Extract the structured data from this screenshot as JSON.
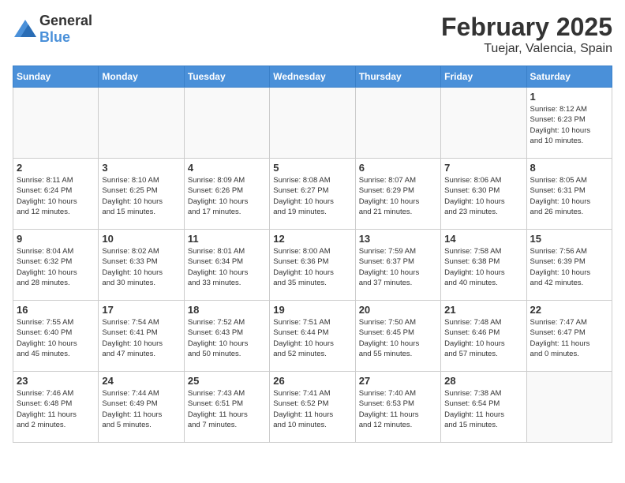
{
  "logo": {
    "general": "General",
    "blue": "Blue"
  },
  "title": "February 2025",
  "location": "Tuejar, Valencia, Spain",
  "days_header": [
    "Sunday",
    "Monday",
    "Tuesday",
    "Wednesday",
    "Thursday",
    "Friday",
    "Saturday"
  ],
  "weeks": [
    [
      {
        "day": "",
        "info": ""
      },
      {
        "day": "",
        "info": ""
      },
      {
        "day": "",
        "info": ""
      },
      {
        "day": "",
        "info": ""
      },
      {
        "day": "",
        "info": ""
      },
      {
        "day": "",
        "info": ""
      },
      {
        "day": "1",
        "info": "Sunrise: 8:12 AM\nSunset: 6:23 PM\nDaylight: 10 hours\nand 10 minutes."
      }
    ],
    [
      {
        "day": "2",
        "info": "Sunrise: 8:11 AM\nSunset: 6:24 PM\nDaylight: 10 hours\nand 12 minutes."
      },
      {
        "day": "3",
        "info": "Sunrise: 8:10 AM\nSunset: 6:25 PM\nDaylight: 10 hours\nand 15 minutes."
      },
      {
        "day": "4",
        "info": "Sunrise: 8:09 AM\nSunset: 6:26 PM\nDaylight: 10 hours\nand 17 minutes."
      },
      {
        "day": "5",
        "info": "Sunrise: 8:08 AM\nSunset: 6:27 PM\nDaylight: 10 hours\nand 19 minutes."
      },
      {
        "day": "6",
        "info": "Sunrise: 8:07 AM\nSunset: 6:29 PM\nDaylight: 10 hours\nand 21 minutes."
      },
      {
        "day": "7",
        "info": "Sunrise: 8:06 AM\nSunset: 6:30 PM\nDaylight: 10 hours\nand 23 minutes."
      },
      {
        "day": "8",
        "info": "Sunrise: 8:05 AM\nSunset: 6:31 PM\nDaylight: 10 hours\nand 26 minutes."
      }
    ],
    [
      {
        "day": "9",
        "info": "Sunrise: 8:04 AM\nSunset: 6:32 PM\nDaylight: 10 hours\nand 28 minutes."
      },
      {
        "day": "10",
        "info": "Sunrise: 8:02 AM\nSunset: 6:33 PM\nDaylight: 10 hours\nand 30 minutes."
      },
      {
        "day": "11",
        "info": "Sunrise: 8:01 AM\nSunset: 6:34 PM\nDaylight: 10 hours\nand 33 minutes."
      },
      {
        "day": "12",
        "info": "Sunrise: 8:00 AM\nSunset: 6:36 PM\nDaylight: 10 hours\nand 35 minutes."
      },
      {
        "day": "13",
        "info": "Sunrise: 7:59 AM\nSunset: 6:37 PM\nDaylight: 10 hours\nand 37 minutes."
      },
      {
        "day": "14",
        "info": "Sunrise: 7:58 AM\nSunset: 6:38 PM\nDaylight: 10 hours\nand 40 minutes."
      },
      {
        "day": "15",
        "info": "Sunrise: 7:56 AM\nSunset: 6:39 PM\nDaylight: 10 hours\nand 42 minutes."
      }
    ],
    [
      {
        "day": "16",
        "info": "Sunrise: 7:55 AM\nSunset: 6:40 PM\nDaylight: 10 hours\nand 45 minutes."
      },
      {
        "day": "17",
        "info": "Sunrise: 7:54 AM\nSunset: 6:41 PM\nDaylight: 10 hours\nand 47 minutes."
      },
      {
        "day": "18",
        "info": "Sunrise: 7:52 AM\nSunset: 6:43 PM\nDaylight: 10 hours\nand 50 minutes."
      },
      {
        "day": "19",
        "info": "Sunrise: 7:51 AM\nSunset: 6:44 PM\nDaylight: 10 hours\nand 52 minutes."
      },
      {
        "day": "20",
        "info": "Sunrise: 7:50 AM\nSunset: 6:45 PM\nDaylight: 10 hours\nand 55 minutes."
      },
      {
        "day": "21",
        "info": "Sunrise: 7:48 AM\nSunset: 6:46 PM\nDaylight: 10 hours\nand 57 minutes."
      },
      {
        "day": "22",
        "info": "Sunrise: 7:47 AM\nSunset: 6:47 PM\nDaylight: 11 hours\nand 0 minutes."
      }
    ],
    [
      {
        "day": "23",
        "info": "Sunrise: 7:46 AM\nSunset: 6:48 PM\nDaylight: 11 hours\nand 2 minutes."
      },
      {
        "day": "24",
        "info": "Sunrise: 7:44 AM\nSunset: 6:49 PM\nDaylight: 11 hours\nand 5 minutes."
      },
      {
        "day": "25",
        "info": "Sunrise: 7:43 AM\nSunset: 6:51 PM\nDaylight: 11 hours\nand 7 minutes."
      },
      {
        "day": "26",
        "info": "Sunrise: 7:41 AM\nSunset: 6:52 PM\nDaylight: 11 hours\nand 10 minutes."
      },
      {
        "day": "27",
        "info": "Sunrise: 7:40 AM\nSunset: 6:53 PM\nDaylight: 11 hours\nand 12 minutes."
      },
      {
        "day": "28",
        "info": "Sunrise: 7:38 AM\nSunset: 6:54 PM\nDaylight: 11 hours\nand 15 minutes."
      },
      {
        "day": "",
        "info": ""
      }
    ]
  ]
}
